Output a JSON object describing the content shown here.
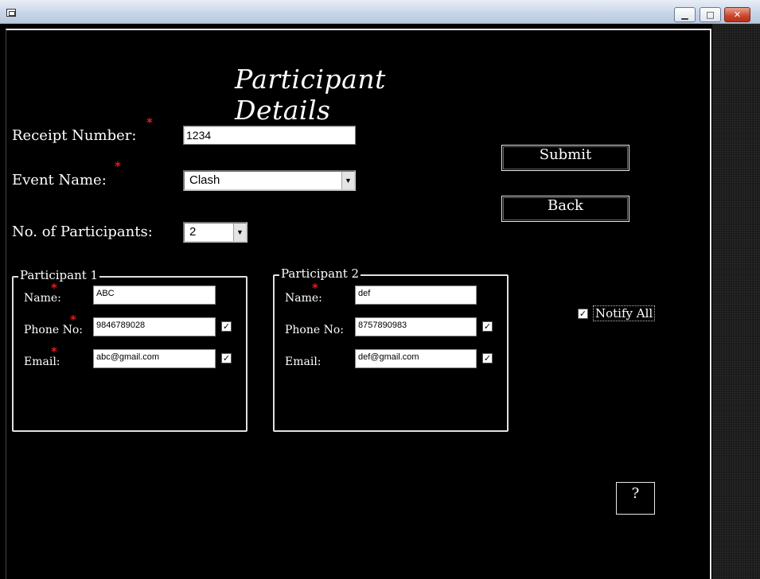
{
  "window": {
    "minimize_glyph": "▁",
    "maximize_glyph": "□",
    "close_glyph": "✕"
  },
  "page_title": "Participant Details",
  "required_marker": "*",
  "fields": {
    "receipt_label": "Receipt Number:",
    "receipt_value": "1234",
    "event_label": "Event Name:",
    "event_value": "Clash",
    "participants_label": "No. of Participants:",
    "participants_value": "2"
  },
  "buttons": {
    "submit": "Submit",
    "back": "Back",
    "help": "?"
  },
  "dropdown_arrow": "▼",
  "check_glyph": "✓",
  "participant1": {
    "title": "Participant 1",
    "name_label": "Name:",
    "name_value": "ABC",
    "phone_label": "Phone No:",
    "phone_value": "9846789028",
    "phone_checked": true,
    "email_label": "Email:",
    "email_value": "abc@gmail.com",
    "email_checked": true
  },
  "participant2": {
    "title": "Participant 2",
    "name_label": "Name:",
    "name_value": "def",
    "phone_label": "Phone No:",
    "phone_value": "8757890983",
    "phone_checked": true,
    "email_label": "Email:",
    "email_value": "def@gmail.com",
    "email_checked": true
  },
  "notify_all": {
    "label": "Notify All",
    "checked": true
  },
  "colors": {
    "background": "#000000",
    "text": "#ffffff",
    "required": "#e8191b"
  }
}
